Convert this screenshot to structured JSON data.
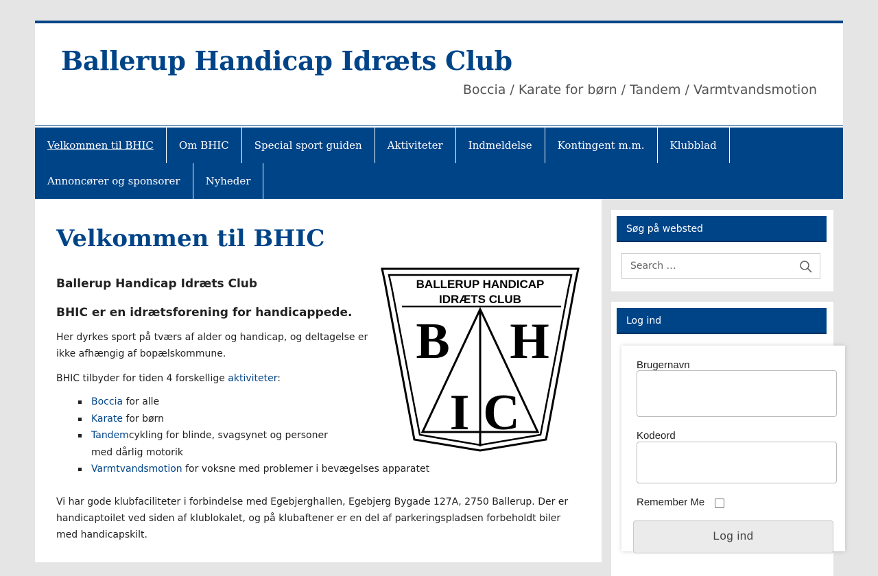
{
  "header": {
    "site_title": "Ballerup Handicap Idræts Club",
    "site_description": "Boccia / Karate for børn / Tandem / Varmtvandsmotion"
  },
  "nav": {
    "row1": [
      "Velkommen til BHIC",
      "Om BHIC",
      "Special sport guiden",
      "Aktiviteter",
      "Indmeldelse",
      "Kontingent m.m.",
      "Klubblad"
    ],
    "row2": [
      "Annoncører og sponsorer",
      "Nyheder"
    ],
    "active": "Velkommen til BHIC"
  },
  "main": {
    "page_title": "Velkommen til BHIC",
    "subheading1": "Ballerup Handicap Idræts Club",
    "subheading2": "BHIC er en idrætsforening for handicappede.",
    "intro": "Her dyrkes sport på tværs af alder og handicap, og deltagelse er ikke afhængig af bopælskommune.",
    "offer_prefix": "BHIC tilbyder for tiden 4 forskellige ",
    "offer_link": "aktiviteter",
    "offer_suffix": ":",
    "activities": [
      {
        "link": "Boccia",
        "rest": " for alle"
      },
      {
        "link": "Karate",
        "rest": " for børn"
      },
      {
        "link": "Tandem",
        "rest": "cykling for blinde, svagsynet og personer med dårlig motorik"
      },
      {
        "link": "Varmtvandsmotion",
        "rest": " for voksne med problemer i bevægelses apparatet"
      }
    ],
    "facilities": "Vi har gode klubfaciliteter i forbindelse med Egebjerghallen, Egebjerg Bygade 127A, 2750 Ballerup. Der er handicaptoilet ved siden af klublokalet, og på klubaftener er en del af parkeringspladsen forbeholdt biler med handicapskilt.",
    "logo": {
      "line1": "BALLERUP HANDICAP",
      "line2": "IDRÆTS CLUB",
      "letters": [
        "B",
        "H",
        "I",
        "C"
      ]
    }
  },
  "sidebar": {
    "search_widget": {
      "title": "Søg på websted",
      "placeholder": "Search …",
      "icon": "search-icon"
    },
    "login_widget": {
      "title": "Log ind",
      "username_label": "Brugernavn",
      "password_label": "Kodeord",
      "remember_label": "Remember Me",
      "remember_checked": false,
      "button_label": "Log ind"
    }
  },
  "colors": {
    "brand_blue": "#004488",
    "background": "#e5e5e5"
  }
}
